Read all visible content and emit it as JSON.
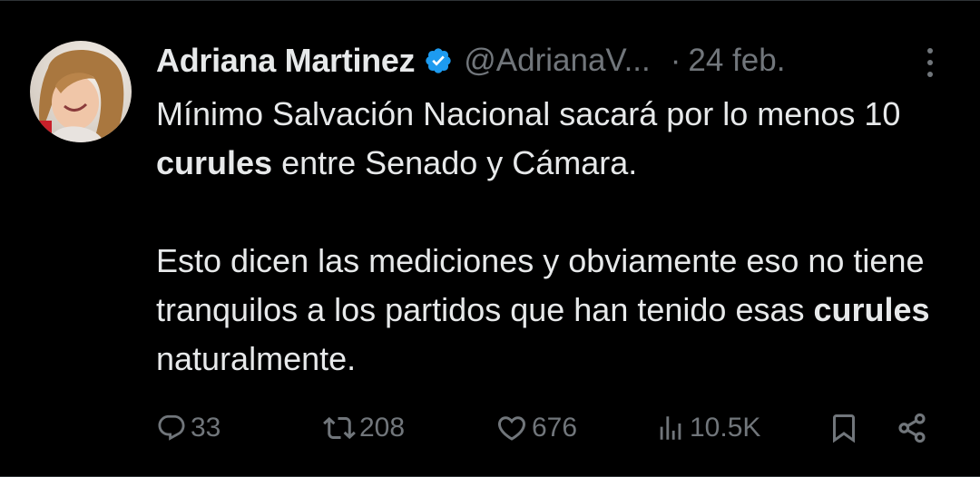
{
  "author": {
    "name": "Adriana Martinez",
    "handle": "@AdrianaV...",
    "separator": "·",
    "date": "24 feb.",
    "verified_badge_color": "#1d9bf0"
  },
  "tweet": {
    "p1_part1": "Mínimo Salvación Nacional sacará por lo menos 10 ",
    "p1_bold": "curules",
    "p1_part2": " entre Senado y Cámara.",
    "p2_part1": "Esto dicen las mediciones y obviamente eso no tiene tranquilos a los partidos que han tenido esas ",
    "p2_bold": "curules",
    "p2_part2": " naturalmente."
  },
  "actions": {
    "replies": "33",
    "retweets": "208",
    "likes": "676",
    "views": "10.5K"
  },
  "icons": {
    "reply": "reply-icon",
    "retweet": "retweet-icon",
    "like": "heart-icon",
    "views": "views-icon",
    "bookmark": "bookmark-icon",
    "share": "share-icon",
    "more": "more-icon"
  },
  "colors": {
    "background": "#000000",
    "text": "#e7e9ea",
    "muted": "#71767b",
    "accent": "#1d9bf0"
  }
}
